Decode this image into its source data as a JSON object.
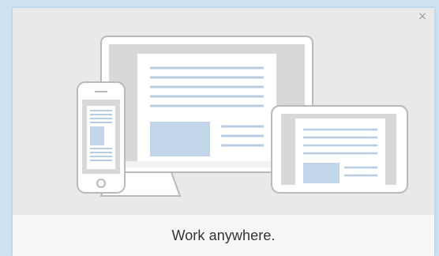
{
  "dialog": {
    "close_glyph": "×",
    "caption": "Work anywhere.",
    "illustration": {
      "icon": "devices-illustration-icon",
      "devices": [
        "desktop-monitor-icon",
        "smartphone-icon",
        "tablet-icon"
      ]
    }
  },
  "colors": {
    "page_background": "#cde3f4",
    "hero_background": "#e9e9e9",
    "caption_background": "#f7f7f7",
    "device_outline": "#b9b9b9",
    "screen_line": "#b7cde3",
    "screen_block": "#c2d6ea"
  }
}
